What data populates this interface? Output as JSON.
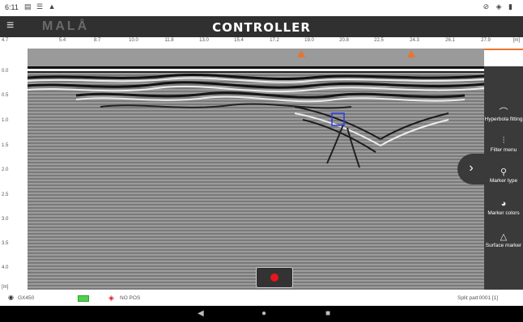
{
  "status_bar": {
    "time": "6:11",
    "left_icons": "▤ ☰ ▲",
    "right_icons": "⊘ ◈ ▮"
  },
  "header": {
    "logo": "MALÅ",
    "title": "CONTROLLER",
    "menu_icon": "≡"
  },
  "distance_ruler": {
    "ticks": [
      "4.7",
      "5.4",
      "8.7",
      "10.0",
      "11.8",
      "13.0",
      "15.4",
      "17.2",
      "19.0",
      "20.8",
      "22.5",
      "24.3",
      "26.1",
      "27.9"
    ],
    "unit": "[m]"
  },
  "surface_markers": [
    19.0,
    24.3
  ],
  "depth_axis": {
    "labels": [
      "0.0",
      "0.5",
      "1.0",
      "1.5",
      "2.0",
      "2.5",
      "3.0",
      "3.5",
      "4.0"
    ],
    "unit": "[m]"
  },
  "right_panel": {
    "hyperbola": {
      "label": "Hyperbola fitting",
      "icon": "hyperbola-icon"
    },
    "filter": {
      "label": "Filter menu",
      "icon": "sliders-icon"
    },
    "marker_type": {
      "label": "Marker type",
      "icon": "pin-icon"
    },
    "marker_colors": {
      "label": "Marker colors",
      "icon": "palette-icon"
    },
    "surface_marker": {
      "label": "Surface marker",
      "icon": "triangle-icon"
    }
  },
  "bottom_bar": {
    "antenna": "GX450",
    "position": "NO POS",
    "split_label": "Split part",
    "split_value": ": 0001 [1]"
  },
  "colors": {
    "accent": "#e9742f",
    "header_bg": "#303030",
    "panel_bg": "#3a3a3a",
    "record": "#e8161b"
  }
}
